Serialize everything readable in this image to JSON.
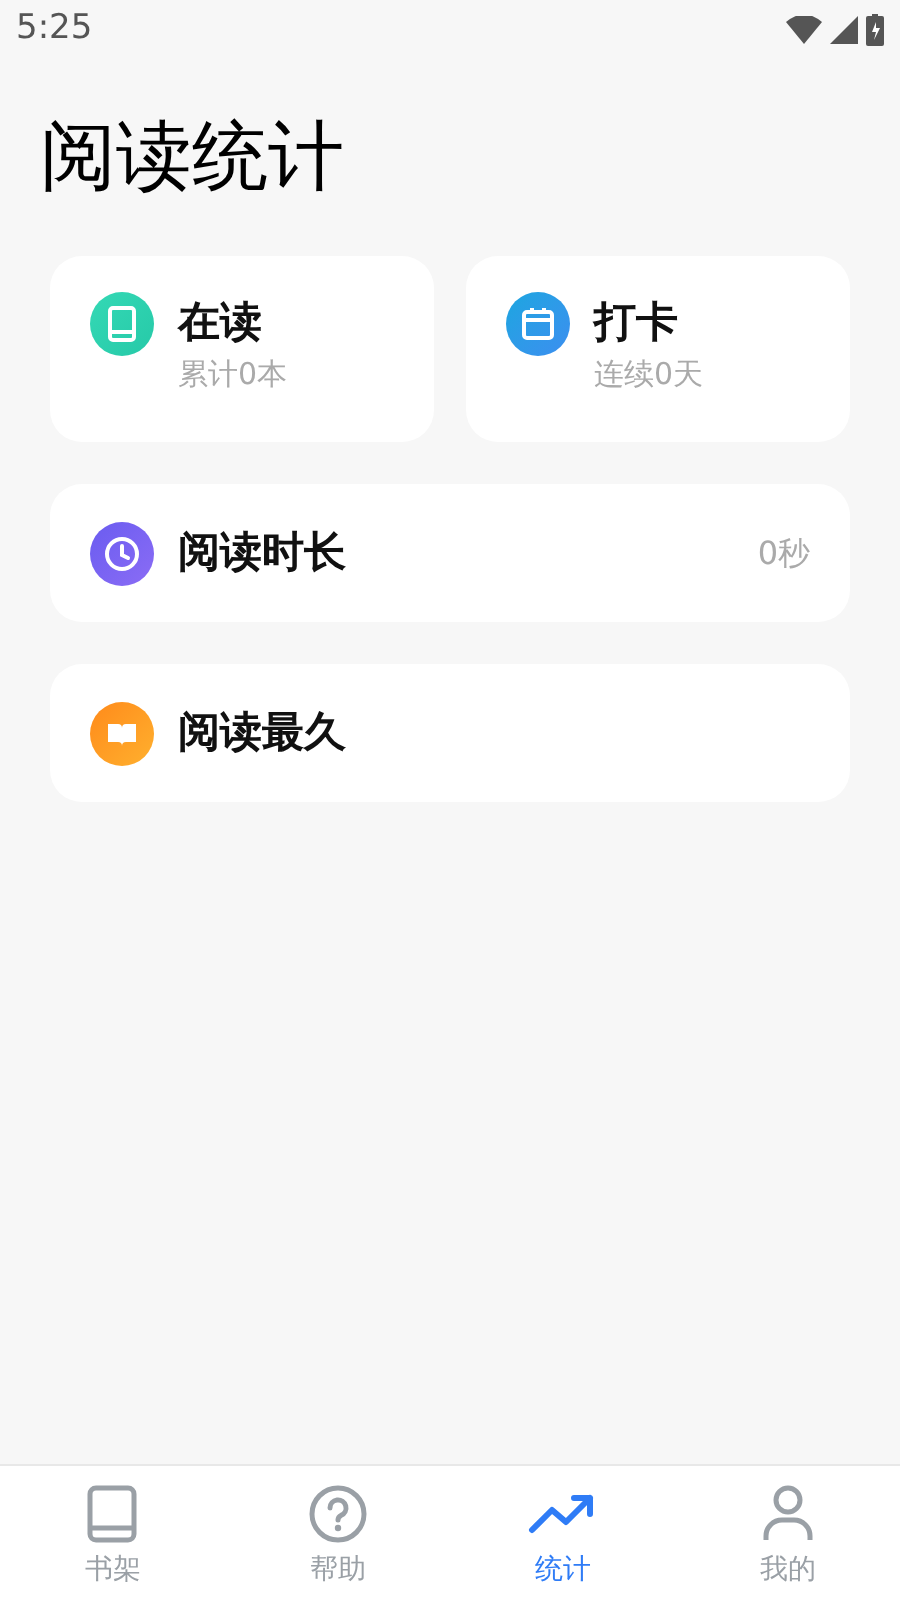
{
  "status_bar": {
    "time": "5:25"
  },
  "title": "阅读统计",
  "summary_cards": [
    {
      "kind": "book",
      "title": "在读",
      "subtitle": "累计0本"
    },
    {
      "kind": "calendar",
      "title": "打卡",
      "subtitle": "连续0天"
    }
  ],
  "rows": [
    {
      "kind": "clock",
      "title": "阅读时长",
      "value": "0秒"
    },
    {
      "kind": "open-book",
      "title": "阅读最久"
    }
  ],
  "nav": [
    {
      "kind": "shelf",
      "label": "书架",
      "selected": false
    },
    {
      "kind": "help",
      "label": "帮助",
      "selected": false
    },
    {
      "kind": "stats",
      "label": "统计",
      "selected": true
    },
    {
      "kind": "profile",
      "label": "我的",
      "selected": false
    }
  ]
}
